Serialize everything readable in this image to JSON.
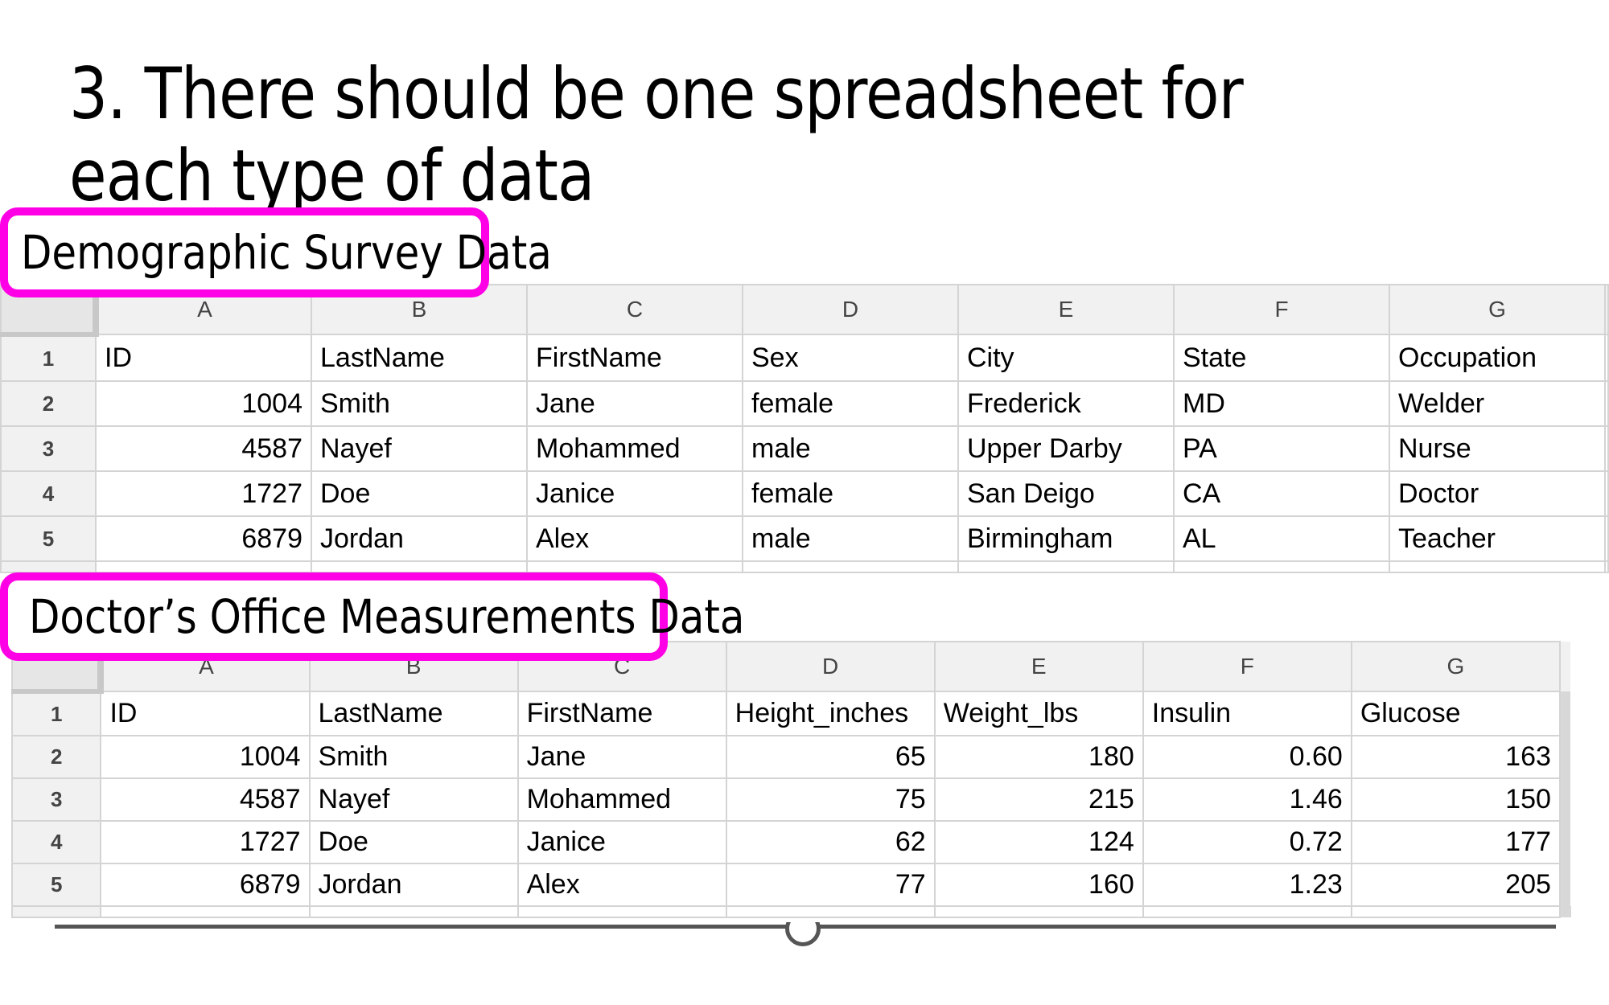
{
  "slide": {
    "title": "3. There should be one spreadsheet for each type of data"
  },
  "colors": {
    "highlight": "#ff00e6",
    "grid": "#d4d4d4",
    "header_bg": "#f1f1f1"
  },
  "demographic": {
    "label": "Demographic Survey Data",
    "columns": [
      "A",
      "B",
      "C",
      "D",
      "E",
      "F",
      "G"
    ],
    "rows": [
      {
        "n": "1",
        "cells": [
          "ID",
          "LastName",
          "FirstName",
          "Sex",
          "City",
          "State",
          "Occupation"
        ]
      },
      {
        "n": "2",
        "cells": [
          "1004",
          "Smith",
          "Jane",
          "female",
          "Frederick",
          "MD",
          "Welder"
        ]
      },
      {
        "n": "3",
        "cells": [
          "4587",
          "Nayef",
          "Mohammed",
          "male",
          "Upper Darby",
          "PA",
          "Nurse"
        ]
      },
      {
        "n": "4",
        "cells": [
          "1727",
          "Doe",
          "Janice",
          "female",
          "San Deigo",
          "CA",
          "Doctor"
        ]
      },
      {
        "n": "5",
        "cells": [
          "6879",
          "Jordan",
          "Alex",
          "male",
          "Birmingham",
          "AL",
          "Teacher"
        ]
      }
    ]
  },
  "doctor": {
    "label": "Doctor’s Office Measurements Data",
    "columns": [
      "A",
      "B",
      "C",
      "D",
      "E",
      "F",
      "G"
    ],
    "rows": [
      {
        "n": "1",
        "cells": [
          "ID",
          "LastName",
          "FirstName",
          "Height_inches",
          "Weight_lbs",
          "Insulin",
          "Glucose"
        ]
      },
      {
        "n": "2",
        "cells": [
          "1004",
          "Smith",
          "Jane",
          "65",
          "180",
          "0.60",
          "163"
        ]
      },
      {
        "n": "3",
        "cells": [
          "4587",
          "Nayef",
          "Mohammed",
          "75",
          "215",
          "1.46",
          "150"
        ]
      },
      {
        "n": "4",
        "cells": [
          "1727",
          "Doe",
          "Janice",
          "62",
          "124",
          "0.72",
          "177"
        ]
      },
      {
        "n": "5",
        "cells": [
          "6879",
          "Jordan",
          "Alex",
          "77",
          "160",
          "1.23",
          "205"
        ]
      }
    ]
  },
  "slider": {
    "icon": "slider-knob"
  }
}
